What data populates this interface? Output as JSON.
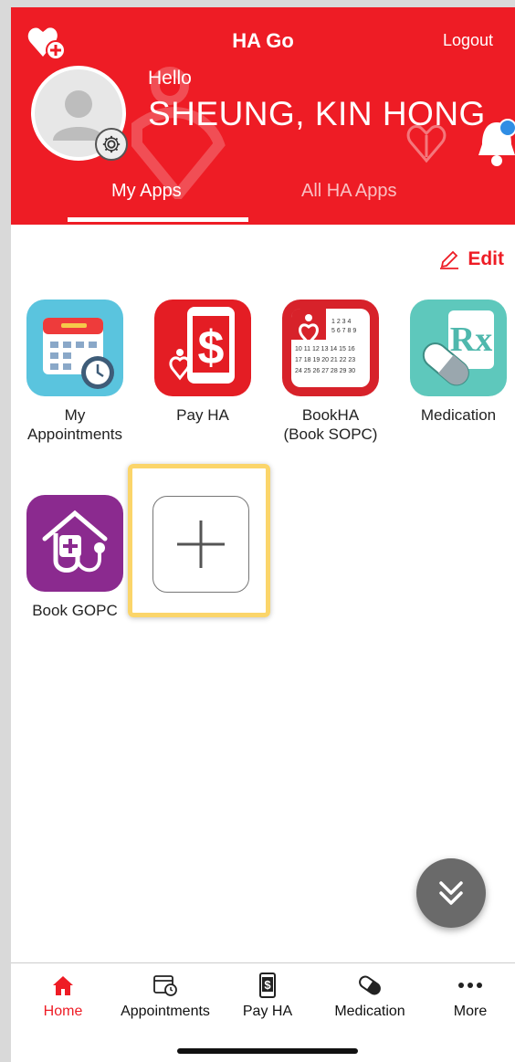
{
  "header": {
    "app_title": "HA Go",
    "logout_label": "Logout",
    "greeting": "Hello",
    "user_name": "SHEUNG, KIN HONG",
    "tabs": [
      {
        "label": "My Apps",
        "active": true
      },
      {
        "label": "All HA Apps",
        "active": false
      }
    ],
    "background_color": "#ee1c25"
  },
  "toolbar": {
    "edit_label": "Edit"
  },
  "apps": [
    {
      "label": "My\nAppointments",
      "icon": "calendar-clock-icon"
    },
    {
      "label": "Pay HA",
      "icon": "pay-ha-icon"
    },
    {
      "label": "BookHA\n(Book SOPC)",
      "icon": "bookha-calendar-icon"
    },
    {
      "label": "Medication",
      "icon": "rx-pill-icon"
    },
    {
      "label": "Book GOPC",
      "icon": "clinic-stethoscope-icon"
    }
  ],
  "add_app": {
    "icon": "plus-icon",
    "highlight_color": "#fbd56a"
  },
  "fab": {
    "icon": "double-chevron-down-icon"
  },
  "tabbar": {
    "items": [
      {
        "label": "Home",
        "icon": "home-icon",
        "active": true
      },
      {
        "label": "Appointments",
        "icon": "calendar-clock-icon",
        "active": false
      },
      {
        "label": "Pay HA",
        "icon": "phone-dollar-icon",
        "active": false
      },
      {
        "label": "Medication",
        "icon": "pill-icon",
        "active": false
      },
      {
        "label": "More",
        "icon": "more-dots-icon",
        "active": false
      }
    ]
  }
}
